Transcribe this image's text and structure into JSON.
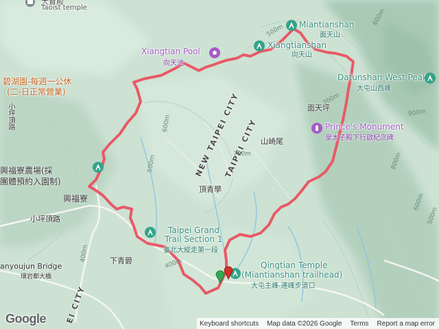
{
  "places": {
    "taoist_temple": {
      "zh": "大寶殿",
      "en": "Taoist temple"
    },
    "miantianshan": {
      "en": "Miantianshan",
      "zh": "面天山"
    },
    "xiangtian_pool": {
      "en": "Xiangtian Pool",
      "zh": "向天池"
    },
    "xiangtianshan": {
      "en": "Xiangtianshan",
      "zh": "向天山"
    },
    "datunshan_west": {
      "en": "Datunshan West Peak",
      "zh": "大屯山西峰"
    },
    "miantianping": {
      "zh": "面天坪"
    },
    "princes_monument": {
      "en": "Prince's Monument",
      "zh": "皇太子殿下行啟紀念碑"
    },
    "shanqiwei": {
      "zh": "山崎尾"
    },
    "dingqingxue": {
      "zh": "頂青學"
    },
    "xiaqingxue": {
      "zh": "下青礐"
    },
    "bihuyuan_1": "碧湖園-每週一公休",
    "bihuyuan_2": "(二-日正常營業)",
    "xiaopingding": "小坪頂路",
    "xiaopingding_v": "小坪頂路",
    "xingfuliao_farm_1": "興福寮農場(採",
    "xingfuliao_farm_2": "團體預約入園制)",
    "xingfuliao": "興福寮",
    "taipei_grand_trail": {
      "en1": "Taipei Grand",
      "en2": "Trail Section 1",
      "zh": "臺北大縱走第一段"
    },
    "qingtian_temple": {
      "en1": "Qingtian Temple",
      "en2": "(Miantianshan trailhead)",
      "zh": "大屯主峰-連峰步道口"
    },
    "yanyoujun_bridge": {
      "en": "anyoujun Bridge",
      "zh": "環岩都大橋"
    },
    "new_taipei_city_1": "NEW TAIPEI CITY",
    "new_taipei_city_2": "TAIPEI CITY",
    "new_taipei_city_3": "EI CITY",
    "xiaoping_rd_bottom": "小坪頂路"
  },
  "elevations": [
    "500m",
    "600m",
    "700m",
    "800m",
    "900m",
    "600m",
    "500m",
    "400m",
    "700m",
    "600m",
    "500m",
    "400m"
  ],
  "colors": {
    "route": "#e85a66",
    "poi": "#34a38a",
    "purple": "#a45bc6",
    "start": "#34a853",
    "end": "#d93025"
  },
  "icons": [
    "hiking-icon",
    "hiking-icon",
    "hiking-icon",
    "hiking-icon",
    "hiking-icon",
    "hiking-icon",
    "pool-icon",
    "monument-icon",
    "temple-icon",
    "start-pin-icon",
    "end-pin-icon"
  ],
  "footer": {
    "logo": "Google",
    "shortcuts": "Keyboard shortcuts",
    "map_data": "Map data ©2026 Google",
    "terms": "Terms",
    "report": "Report a map error"
  }
}
